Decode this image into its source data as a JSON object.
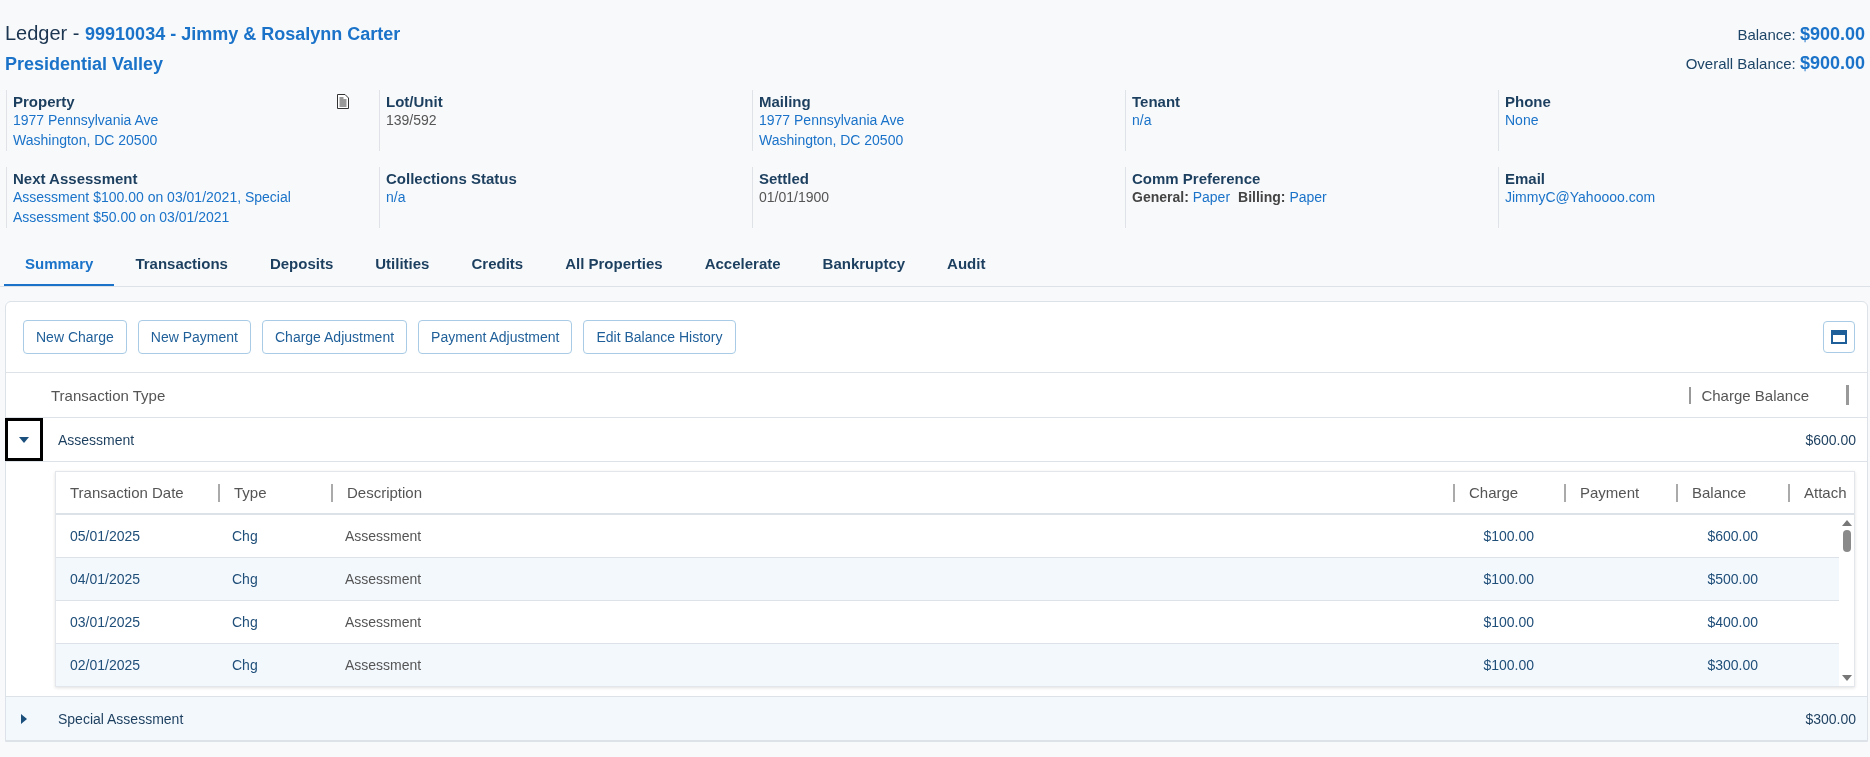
{
  "header": {
    "title_prefix": "Ledger -",
    "account": "99910034 - Jimmy & Rosalynn Carter",
    "community": "Presidential Valley"
  },
  "balances": [
    {
      "label": "Balance:",
      "value": "$900.00"
    },
    {
      "label": "Overall Balance:",
      "value": "$900.00"
    }
  ],
  "info_fields": [
    {
      "label": "Property",
      "kind": "link",
      "lines": [
        "1977 Pennsylvania Ave",
        "Washington, DC 20500"
      ],
      "has_document": true
    },
    {
      "label": "Lot/Unit",
      "kind": "plain",
      "lines": [
        "139/592"
      ],
      "has_document": false
    },
    {
      "label": "Mailing",
      "kind": "link",
      "lines": [
        "1977 Pennsylvania Ave",
        "Washington, DC 20500"
      ],
      "has_document": false
    },
    {
      "label": "Tenant",
      "kind": "link",
      "lines": [
        "n/a"
      ],
      "has_document": false
    },
    {
      "label": "Phone",
      "kind": "link",
      "lines": [
        "None"
      ],
      "has_document": false
    },
    {
      "label": "Next Assessment",
      "kind": "link",
      "lines": [
        "Assessment $100.00 on 03/01/2021, Special Assessment $50.00 on 03/01/2021"
      ],
      "has_document": false
    },
    {
      "label": "Collections Status",
      "kind": "link",
      "lines": [
        "n/a"
      ],
      "has_document": false
    },
    {
      "label": "Settled",
      "kind": "plain",
      "lines": [
        "01/01/1900"
      ],
      "has_document": false
    },
    {
      "label": "Comm Preference",
      "kind": "prefs",
      "prefs": [
        {
          "name": "General:",
          "value": "Paper"
        },
        {
          "name": "Billing:",
          "value": "Paper"
        }
      ],
      "has_document": false
    },
    {
      "label": "Email",
      "kind": "link",
      "lines": [
        "JimmyC@Yahoooo.com"
      ],
      "has_document": false
    }
  ],
  "tabs": [
    {
      "label": "Summary",
      "selected": true
    },
    {
      "label": "Transactions",
      "selected": false
    },
    {
      "label": "Deposits",
      "selected": false
    },
    {
      "label": "Utilities",
      "selected": false
    },
    {
      "label": "Credits",
      "selected": false
    },
    {
      "label": "All Properties",
      "selected": false
    },
    {
      "label": "Accelerate",
      "selected": false
    },
    {
      "label": "Bankruptcy",
      "selected": false
    },
    {
      "label": "Audit",
      "selected": false
    }
  ],
  "toolbar_buttons": [
    "New Charge",
    "New Payment",
    "Charge Adjustment",
    "Payment Adjustment",
    "Edit Balance History"
  ],
  "summary_columns": [
    "Transaction Type",
    "Charge Balance"
  ],
  "detail_columns": [
    "Transaction Date",
    "Type",
    "Description",
    "Charge",
    "Payment",
    "Balance",
    "Attach"
  ],
  "groups": [
    {
      "name": "Assessment",
      "balance": "$600.00",
      "expanded": true,
      "focused": true,
      "rows": [
        {
          "date": "05/01/2025",
          "type": "Chg",
          "description": "Assessment",
          "charge": "$100.00",
          "balance": "$600.00"
        },
        {
          "date": "04/01/2025",
          "type": "Chg",
          "description": "Assessment",
          "charge": "$100.00",
          "balance": "$500.00"
        },
        {
          "date": "03/01/2025",
          "type": "Chg",
          "description": "Assessment",
          "charge": "$100.00",
          "balance": "$400.00"
        },
        {
          "date": "02/01/2025",
          "type": "Chg",
          "description": "Assessment",
          "charge": "$100.00",
          "balance": "$300.00"
        }
      ]
    },
    {
      "name": "Special Assessment",
      "balance": "$300.00",
      "expanded": false,
      "focused": false
    }
  ]
}
